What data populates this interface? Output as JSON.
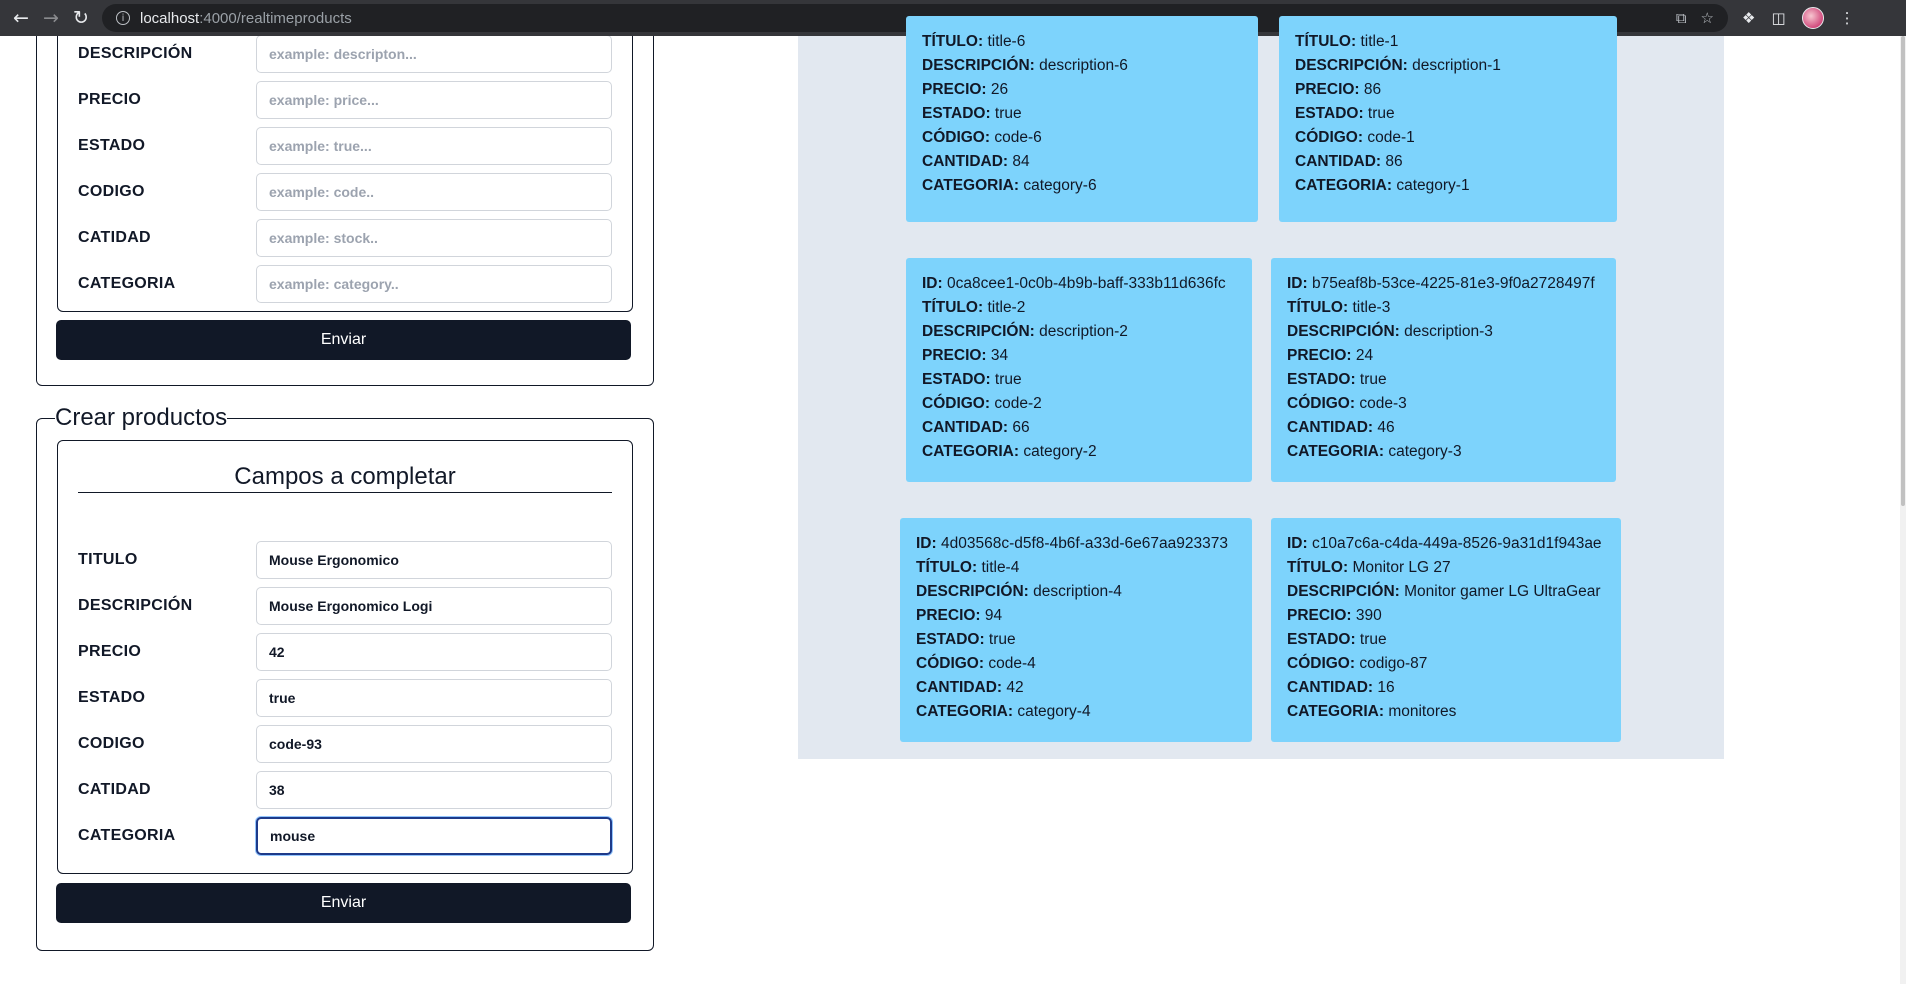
{
  "browser": {
    "url_host": "localhost",
    "url_path": ":4000/realtimeproducts"
  },
  "update_form": {
    "fields": [
      {
        "label": "DESCRIPCIÓN",
        "value": "",
        "placeholder": "example: descripton..."
      },
      {
        "label": "PRECIO",
        "value": "",
        "placeholder": "example: price..."
      },
      {
        "label": "ESTADO",
        "value": "",
        "placeholder": "example: true..."
      },
      {
        "label": "CODIGO",
        "value": "",
        "placeholder": "example: code.."
      },
      {
        "label": "CATIDAD",
        "value": "",
        "placeholder": "example: stock.."
      },
      {
        "label": "CATEGORIA",
        "value": "",
        "placeholder": "example: category.."
      }
    ],
    "submit_label": "Enviar"
  },
  "create_form": {
    "legend": "Crear productos",
    "title": "Campos a completar",
    "fields": [
      {
        "label": "TITULO",
        "value": "Mouse Ergonomico"
      },
      {
        "label": "DESCRIPCIÓN",
        "value": "Mouse Ergonomico Logi"
      },
      {
        "label": "PRECIO",
        "value": "42"
      },
      {
        "label": "ESTADO",
        "value": "true"
      },
      {
        "label": "CODIGO",
        "value": "code-93"
      },
      {
        "label": "CATIDAD",
        "value": "38"
      },
      {
        "label": "CATEGORIA",
        "value": "mouse"
      }
    ],
    "submit_label": "Enviar"
  },
  "field_labels": {
    "id": "ID:",
    "title": "TÍTULO:",
    "description": "DESCRIPCIÓN:",
    "price": "PRECIO:",
    "status": "ESTADO:",
    "code": "CÓDIGO:",
    "stock": "CANTIDAD:",
    "category": "CATEGORIA:"
  },
  "products": [
    {
      "id": "",
      "title": "title-6",
      "description": "description-6",
      "price": "26",
      "status": "true",
      "code": "code-6",
      "stock": "84",
      "category": "category-6"
    },
    {
      "id": "",
      "title": "title-1",
      "description": "description-1",
      "price": "86",
      "status": "true",
      "code": "code-1",
      "stock": "86",
      "category": "category-1"
    },
    {
      "id": "0ca8cee1-0c0b-4b9b-baff-333b11d636fc",
      "title": "title-2",
      "description": "description-2",
      "price": "34",
      "status": "true",
      "code": "code-2",
      "stock": "66",
      "category": "category-2"
    },
    {
      "id": "b75eaf8b-53ce-4225-81e3-9f0a2728497f",
      "title": "title-3",
      "description": "description-3",
      "price": "24",
      "status": "true",
      "code": "code-3",
      "stock": "46",
      "category": "category-3"
    },
    {
      "id": "4d03568c-d5f8-4b6f-a33d-6e67aa923373",
      "title": "title-4",
      "description": "description-4",
      "price": "94",
      "status": "true",
      "code": "code-4",
      "stock": "42",
      "category": "category-4"
    },
    {
      "id": "c10a7c6a-c4da-449a-8526-9a31d1f943ae",
      "title": "Monitor LG 27",
      "description": "Monitor gamer LG UltraGear",
      "price": "390",
      "status": "true",
      "code": "codigo-87",
      "stock": "16",
      "category": "monitores"
    }
  ]
}
